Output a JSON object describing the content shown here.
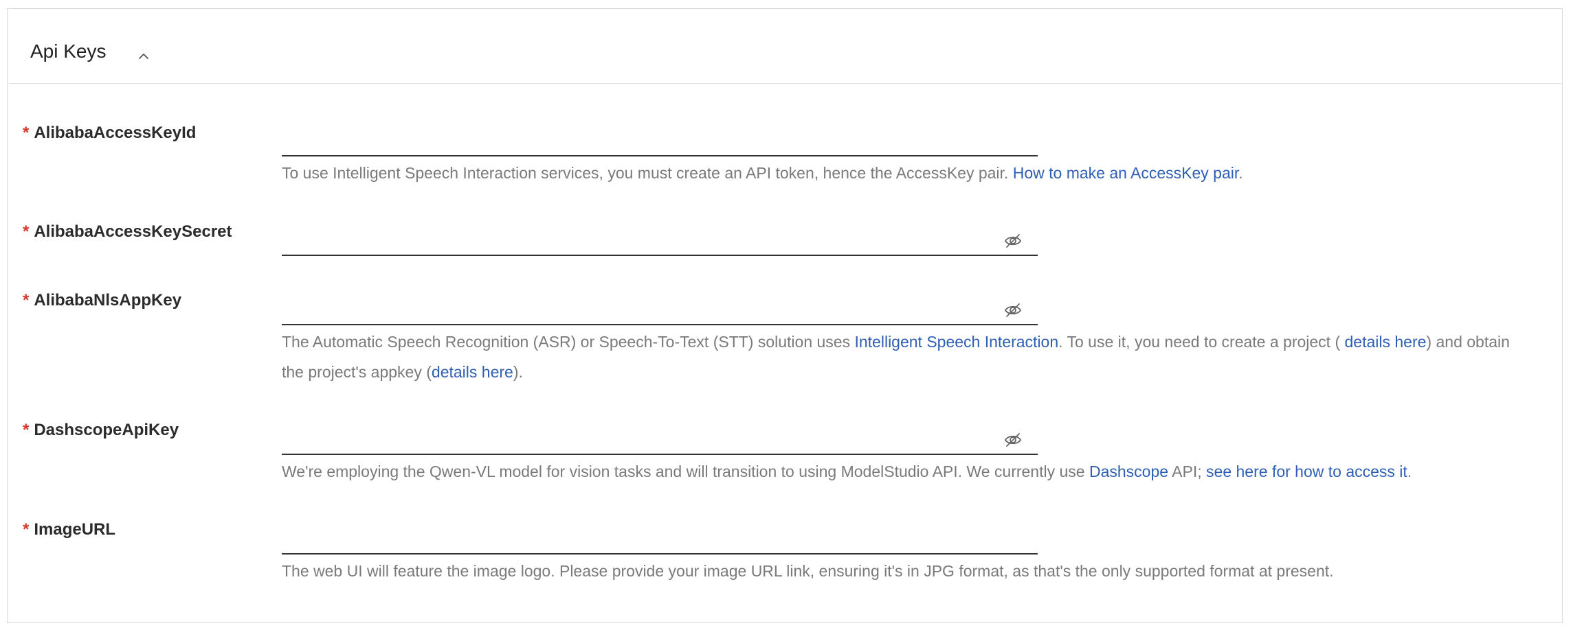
{
  "panel": {
    "title": "Api Keys",
    "toggle_icon": "chevron-up-icon"
  },
  "fields": {
    "access_key_id": {
      "required_mark": "*",
      "label": "AlibabaAccessKeyId",
      "value": "",
      "help_before": "To use Intelligent Speech Interaction services, you must create an API token, hence the AccessKey pair. ",
      "help_link": "How to make an AccessKey pair",
      "help_after": "."
    },
    "access_key_secret": {
      "required_mark": "*",
      "label": "AlibabaAccessKeySecret",
      "value": "",
      "icon": "eye-off-icon"
    },
    "nls_app_key": {
      "required_mark": "*",
      "label": "AlibabaNlsAppKey",
      "value": "",
      "icon": "eye-off-icon",
      "help_part1": "The Automatic Speech Recognition (ASR) or Speech-To-Text (STT) solution uses ",
      "help_link1": "Intelligent Speech Interaction",
      "help_part2": ". To use it, you need to create a project ( ",
      "help_link2": "details here",
      "help_part3": ") and obtain the project's appkey (",
      "help_link3": "details here",
      "help_part4": ")."
    },
    "dashscope_api_key": {
      "required_mark": "*",
      "label": "DashscopeApiKey",
      "value": "",
      "icon": "eye-off-icon",
      "help_part1": "We're employing the Qwen-VL model for vision tasks and will transition to using ModelStudio API. We currently use ",
      "help_link1": "Dashscope",
      "help_part2": " API; ",
      "help_link2": "see here for how to access it",
      "help_part3": "."
    },
    "image_url": {
      "required_mark": "*",
      "label": "ImageURL",
      "value": "",
      "help": "The web UI will feature the image logo. Please provide your image URL link, ensuring it's in JPG format, as that's the only supported format at present."
    }
  },
  "colors": {
    "required": "#d9362b",
    "link": "#2f5fb3",
    "help_text": "#7a7a7a",
    "border": "#dcdcdc"
  }
}
